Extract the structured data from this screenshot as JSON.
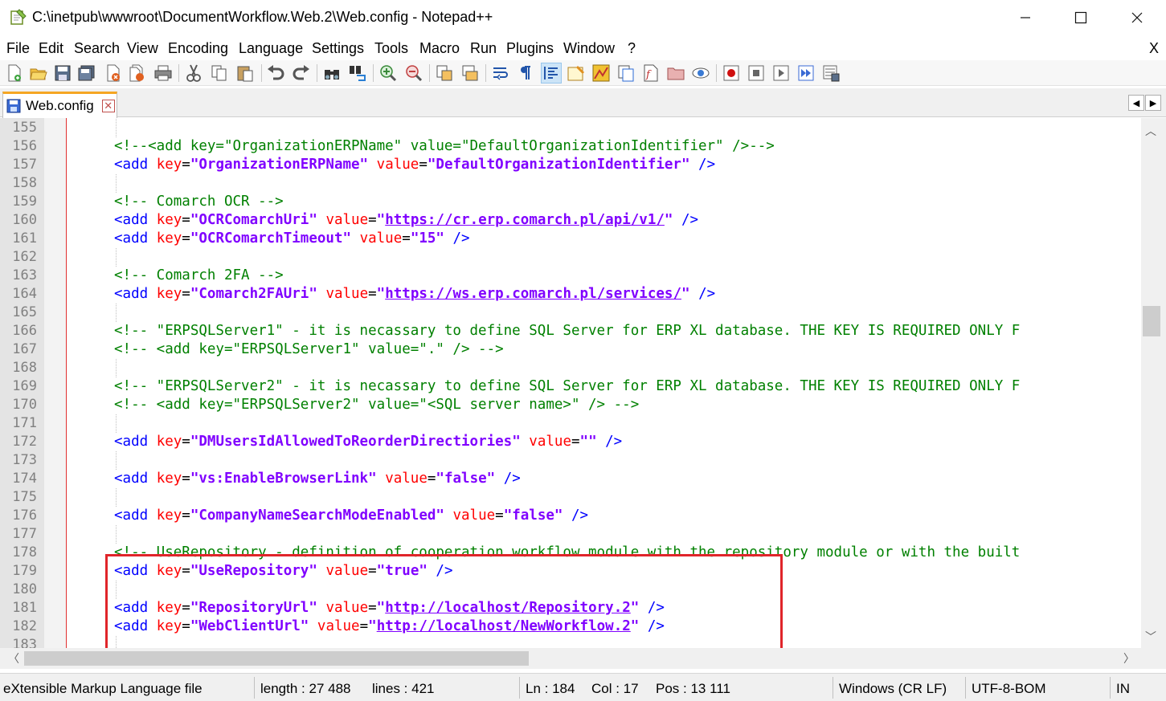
{
  "window": {
    "title": "C:\\inetpub\\wwwroot\\DocumentWorkflow.Web.2\\Web.config - Notepad++",
    "minimize_label": "—",
    "maximize_label": "☐",
    "close_label": "✕"
  },
  "menu": {
    "items": [
      "File",
      "Edit",
      "Search",
      "View",
      "Encoding",
      "Language",
      "Settings",
      "Tools",
      "Macro",
      "Run",
      "Plugins",
      "Window",
      "?"
    ],
    "close_doc": "X"
  },
  "toolbar": {
    "icons": [
      "new-file-icon",
      "open-file-icon",
      "save-icon",
      "save-all-icon",
      "close-icon",
      "close-all-icon",
      "print-icon",
      "cut-icon",
      "copy-icon",
      "paste-icon",
      "undo-icon",
      "redo-icon",
      "find-icon",
      "replace-icon",
      "zoom-in-icon",
      "zoom-out-icon",
      "sync-vertical-icon",
      "sync-horizontal-icon",
      "word-wrap-icon",
      "show-all-chars-icon",
      "indent-guide-icon",
      "udl-icon",
      "doc-map-icon",
      "doc-list-icon",
      "function-list-icon",
      "folder-workspace-icon",
      "monitoring-icon",
      "record-macro-icon",
      "stop-record-icon",
      "play-macro-icon",
      "run-macro-multiple-icon",
      "save-macro-icon"
    ],
    "active_icon": "indent-guide-icon"
  },
  "tab": {
    "label": "Web.config",
    "close_label": "✕"
  },
  "editor": {
    "lines": [
      {
        "n": "155",
        "t": []
      },
      {
        "n": "156",
        "t": [
          [
            "c",
            "<!--<add key=\"OrganizationERPName\" value=\"DefaultOrganizationIdentifier\" />-->"
          ]
        ]
      },
      {
        "n": "157",
        "t": [
          [
            "tag",
            "<add "
          ],
          [
            "attr",
            "key"
          ],
          [
            "p",
            "="
          ],
          [
            "val",
            "\"OrganizationERPName\""
          ],
          [
            "p",
            " "
          ],
          [
            "attr",
            "value"
          ],
          [
            "p",
            "="
          ],
          [
            "val",
            "\"DefaultOrganizationIdentifier\""
          ],
          [
            "tag",
            " />"
          ]
        ]
      },
      {
        "n": "158",
        "t": []
      },
      {
        "n": "159",
        "t": [
          [
            "c",
            "<!-- Comarch OCR -->"
          ]
        ]
      },
      {
        "n": "160",
        "t": [
          [
            "tag",
            "<add "
          ],
          [
            "attr",
            "key"
          ],
          [
            "p",
            "="
          ],
          [
            "val",
            "\"OCRComarchUri\""
          ],
          [
            "p",
            " "
          ],
          [
            "attr",
            "value"
          ],
          [
            "p",
            "="
          ],
          [
            "val",
            "\""
          ],
          [
            "url",
            "https://cr.erp.comarch.pl/api/v1/"
          ],
          [
            "val",
            "\""
          ],
          [
            "tag",
            " />"
          ]
        ]
      },
      {
        "n": "161",
        "t": [
          [
            "tag",
            "<add "
          ],
          [
            "attr",
            "key"
          ],
          [
            "p",
            "="
          ],
          [
            "val",
            "\"OCRComarchTimeout\""
          ],
          [
            "p",
            " "
          ],
          [
            "attr",
            "value"
          ],
          [
            "p",
            "="
          ],
          [
            "val",
            "\"15\""
          ],
          [
            "tag",
            " />"
          ]
        ]
      },
      {
        "n": "162",
        "t": []
      },
      {
        "n": "163",
        "t": [
          [
            "c",
            "<!-- Comarch 2FA -->"
          ]
        ]
      },
      {
        "n": "164",
        "t": [
          [
            "tag",
            "<add "
          ],
          [
            "attr",
            "key"
          ],
          [
            "p",
            "="
          ],
          [
            "val",
            "\"Comarch2FAUri\""
          ],
          [
            "p",
            " "
          ],
          [
            "attr",
            "value"
          ],
          [
            "p",
            "="
          ],
          [
            "val",
            "\""
          ],
          [
            "url",
            "https://ws.erp.comarch.pl/services/"
          ],
          [
            "val",
            "\""
          ],
          [
            "tag",
            " />"
          ]
        ]
      },
      {
        "n": "165",
        "t": []
      },
      {
        "n": "166",
        "t": [
          [
            "c",
            "<!-- \"ERPSQLServer1\" - it is necassary to define SQL Server for ERP XL database. THE KEY IS REQUIRED ONLY F"
          ]
        ]
      },
      {
        "n": "167",
        "t": [
          [
            "c",
            "<!-- <add key=\"ERPSQLServer1\" value=\".\" /> -->"
          ]
        ]
      },
      {
        "n": "168",
        "t": []
      },
      {
        "n": "169",
        "t": [
          [
            "c",
            "<!-- \"ERPSQLServer2\" - it is necassary to define SQL Server for ERP XL database. THE KEY IS REQUIRED ONLY F"
          ]
        ]
      },
      {
        "n": "170",
        "t": [
          [
            "c",
            "<!-- <add key=\"ERPSQLServer2\" value=\"<SQL server name>\" /> -->"
          ]
        ]
      },
      {
        "n": "171",
        "t": []
      },
      {
        "n": "172",
        "t": [
          [
            "tag",
            "<add "
          ],
          [
            "attr",
            "key"
          ],
          [
            "p",
            "="
          ],
          [
            "val",
            "\"DMUsersIdAllowedToReorderDirectiories\""
          ],
          [
            "p",
            " "
          ],
          [
            "attr",
            "value"
          ],
          [
            "p",
            "="
          ],
          [
            "val",
            "\"\""
          ],
          [
            "tag",
            " />"
          ]
        ]
      },
      {
        "n": "173",
        "t": []
      },
      {
        "n": "174",
        "t": [
          [
            "tag",
            "<add "
          ],
          [
            "attr",
            "key"
          ],
          [
            "p",
            "="
          ],
          [
            "val",
            "\"vs:EnableBrowserLink\""
          ],
          [
            "p",
            " "
          ],
          [
            "attr",
            "value"
          ],
          [
            "p",
            "="
          ],
          [
            "val",
            "\"false\""
          ],
          [
            "tag",
            " />"
          ]
        ]
      },
      {
        "n": "175",
        "t": []
      },
      {
        "n": "176",
        "t": [
          [
            "tag",
            "<add "
          ],
          [
            "attr",
            "key"
          ],
          [
            "p",
            "="
          ],
          [
            "val",
            "\"CompanyNameSearchModeEnabled\""
          ],
          [
            "p",
            " "
          ],
          [
            "attr",
            "value"
          ],
          [
            "p",
            "="
          ],
          [
            "val",
            "\"false\""
          ],
          [
            "tag",
            " />"
          ]
        ]
      },
      {
        "n": "177",
        "t": []
      },
      {
        "n": "178",
        "t": [
          [
            "c",
            "<!-- UseRepository - definition of cooperation workflow module with the repository module or with the built"
          ]
        ]
      },
      {
        "n": "179",
        "t": [
          [
            "tag",
            "<add "
          ],
          [
            "attr",
            "key"
          ],
          [
            "p",
            "="
          ],
          [
            "val",
            "\"UseRepository\""
          ],
          [
            "p",
            " "
          ],
          [
            "attr",
            "value"
          ],
          [
            "p",
            "="
          ],
          [
            "val",
            "\"true\""
          ],
          [
            "tag",
            " />"
          ]
        ]
      },
      {
        "n": "180",
        "t": []
      },
      {
        "n": "181",
        "t": [
          [
            "tag",
            "<add "
          ],
          [
            "attr",
            "key"
          ],
          [
            "p",
            "="
          ],
          [
            "val",
            "\"RepositoryUrl\""
          ],
          [
            "p",
            " "
          ],
          [
            "attr",
            "value"
          ],
          [
            "p",
            "="
          ],
          [
            "val",
            "\""
          ],
          [
            "url",
            "http://localhost/Repository.2"
          ],
          [
            "val",
            "\""
          ],
          [
            "tag",
            " />"
          ]
        ]
      },
      {
        "n": "182",
        "t": [
          [
            "tag",
            "<add "
          ],
          [
            "attr",
            "key"
          ],
          [
            "p",
            "="
          ],
          [
            "val",
            "\"WebClientUrl\""
          ],
          [
            "p",
            " "
          ],
          [
            "attr",
            "value"
          ],
          [
            "p",
            "="
          ],
          [
            "val",
            "\""
          ],
          [
            "url",
            "http://localhost/NewWorkflow.2"
          ],
          [
            "val",
            "\""
          ],
          [
            "tag",
            " />"
          ]
        ]
      },
      {
        "n": "183",
        "t": []
      }
    ]
  },
  "statusbar": {
    "file_type": "eXtensible Markup Language file",
    "length": "length : 27 488",
    "lines": "lines : 421",
    "ln": "Ln : 184",
    "col": "Col : 17",
    "pos": "Pos : 13 111",
    "eol": "Windows (CR LF)",
    "encoding": "UTF-8-BOM",
    "mode": "IN"
  },
  "colors": {
    "comment": "#008000",
    "tag": "#0000ff",
    "attribute": "#ff0000",
    "value": "#8000ff",
    "highlight_box": "#e0252a"
  }
}
